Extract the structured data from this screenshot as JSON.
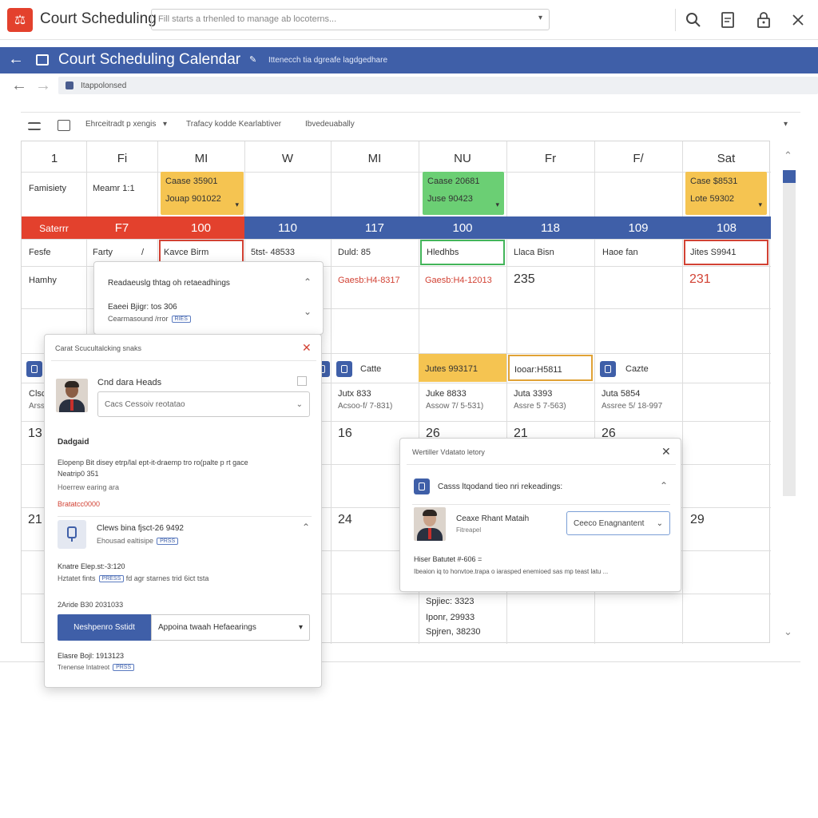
{
  "app": {
    "title": "Court Scheduling",
    "search_placeholder": "Fill starts a trhenled to manage ab locoterns..."
  },
  "icons": {
    "logo": "gavel-icon",
    "search": "search-icon",
    "doc": "document-icon",
    "lock": "lock-icon",
    "close": "close-icon"
  },
  "calendar_header": {
    "title": "Court Scheduling Calendar",
    "subtitle": "Ittenecch tia dgreafe lagdgedhare"
  },
  "breadcrumb": "Itappolonsed",
  "toolbar": {
    "filter_label": "Ehrceitradt p xengis",
    "filter_caret": "▾",
    "middle_text": "Trafacy kodde Kearlabtiver",
    "right_text": "Ibvedeuabally"
  },
  "columns": [
    "1",
    "Fi",
    "MI",
    "W",
    "MI",
    "NU",
    "Fr",
    "F/",
    "Sat"
  ],
  "row_labels": {
    "row1": "Famisiety",
    "row3": "Fesfe",
    "row4": "Hamhy"
  },
  "row1": {
    "col2": "Meamr 1:1",
    "col3_a": "Caase 35901",
    "col3_b": "Jouap 901022",
    "col6_a": "Caase 20681",
    "col6_b": "Juse 90423",
    "col9_a": "Case $8531",
    "col9_b": "Lote 59302"
  },
  "band": {
    "label": "Saterrr",
    "values": [
      "F7",
      "100",
      "110",
      "117",
      "100",
      "118",
      "109",
      "108"
    ]
  },
  "row3": {
    "c2": "Farty",
    "c2b": "/",
    "c3": "Kavce Birm",
    "c4": "5tst- 48533",
    "c5": "Duld: 85",
    "c6": "Hledhbs",
    "c7": "Llaca Bisn",
    "c8": "Haoe fan",
    "c9": "Jites S9941"
  },
  "row4": {
    "c5": "Gaesb:H4-8317",
    "c6": "Gaesb:H4-12013",
    "c7": "235",
    "c9": "231"
  },
  "row6": {
    "c4_label": "Catte",
    "c6": "Jutes 993171",
    "c7": "Iooar:H5811",
    "c8_label": "Cazte"
  },
  "row7": {
    "c1a": "Clsc",
    "c1b": "Arss",
    "c5a": "Jutx 833",
    "c5b": "Acsoo-f/ 7-831)",
    "c6a": "Juke 8833",
    "c6b": "Assow 7/ 5-531)",
    "c7a": "Juta 3393",
    "c7b": "Assre 5 7-563)",
    "c8a": "Juta 5854",
    "c8b": "Assree 5/ 18-997"
  },
  "row8": {
    "c1": "13",
    "c5": "16",
    "c6": "26",
    "c7": "21",
    "c8": "26"
  },
  "row9": {
    "c1": "21",
    "c5": "24",
    "c9": "29"
  },
  "row11": {
    "a": "Spjiec: 3323",
    "b": "Iponr, 29933",
    "c": "Spjren, 38230"
  },
  "panel_resched": {
    "title": "Readaeuslg thtag oh retaeadhings",
    "line1": "Eaeei Bjigr: tos 306",
    "line2": "Cearmasound /rror",
    "tag": "RIES"
  },
  "panel_cart": {
    "title": "Carat Scucultalcking snaks",
    "person": "Cnd dara Heads",
    "select": "Cacs Cessoiv reotatao",
    "section": "Dadgaid",
    "desc1": "Elopenp Bit disey etrp/lal ept-it-draemp tro ro(palte p rt gace",
    "desc2": "Neatrip0 351",
    "desc3": "Hoerrew earing ara",
    "red": "Bratatcc0000",
    "item_title": "Clews bina fjsct-26 9492",
    "item_sub": "Ehousad ealtisipe",
    "item_tag": "PRSS",
    "n1": "Knatre Elep.st:-3:120",
    "n2": "Hztatet fints",
    "n2_tag": "PRESS",
    "n2b": "fd agr starnes trid 6ict tsta",
    "n3": "2Aride B30 2031033",
    "btn_primary": "Neshpenro Sstidt",
    "btn_select": "Appoina twaah Hefaearings",
    "foot1": "Elasre Bojl: 1913123",
    "foot2": "Trenense Intatreot",
    "foot_tag": "PRSS"
  },
  "panel_case": {
    "title": "Wertiller Vdatato letory",
    "subtitle": "Casss ltqodand tieo nri rekeadings:",
    "person": "Ceaxe Rhant Mataih",
    "person_sub": "Fitreapel",
    "select": "Ceeco Enagnantent",
    "line1": "Hiser Batutet #-606 =",
    "line2": "Ibeaion iq to honvtoe.trapa o iarasped enemioed sas mp teast latu ..."
  }
}
